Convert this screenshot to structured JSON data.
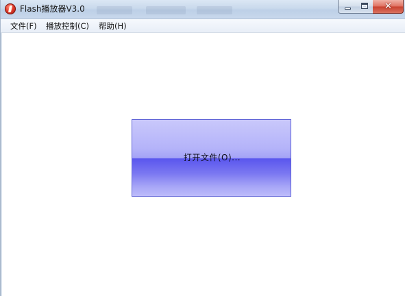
{
  "window": {
    "title": "Flash播放器V3.0",
    "icon": "flash-player-icon",
    "controls": {
      "minimize_icon": "minimize-icon",
      "maximize_icon": "maximize-icon",
      "close_glyph": "✕"
    }
  },
  "menubar": {
    "items": [
      {
        "label": "文件(F)"
      },
      {
        "label": "播放控制(C)"
      },
      {
        "label": "帮助(H)"
      }
    ]
  },
  "main": {
    "open_button_label": "打开文件(O)..."
  },
  "colors": {
    "button_top": "#c9c8fb",
    "button_mid": "#5a56ee",
    "button_border": "#5b5fd6",
    "close_button": "#c9412f"
  }
}
